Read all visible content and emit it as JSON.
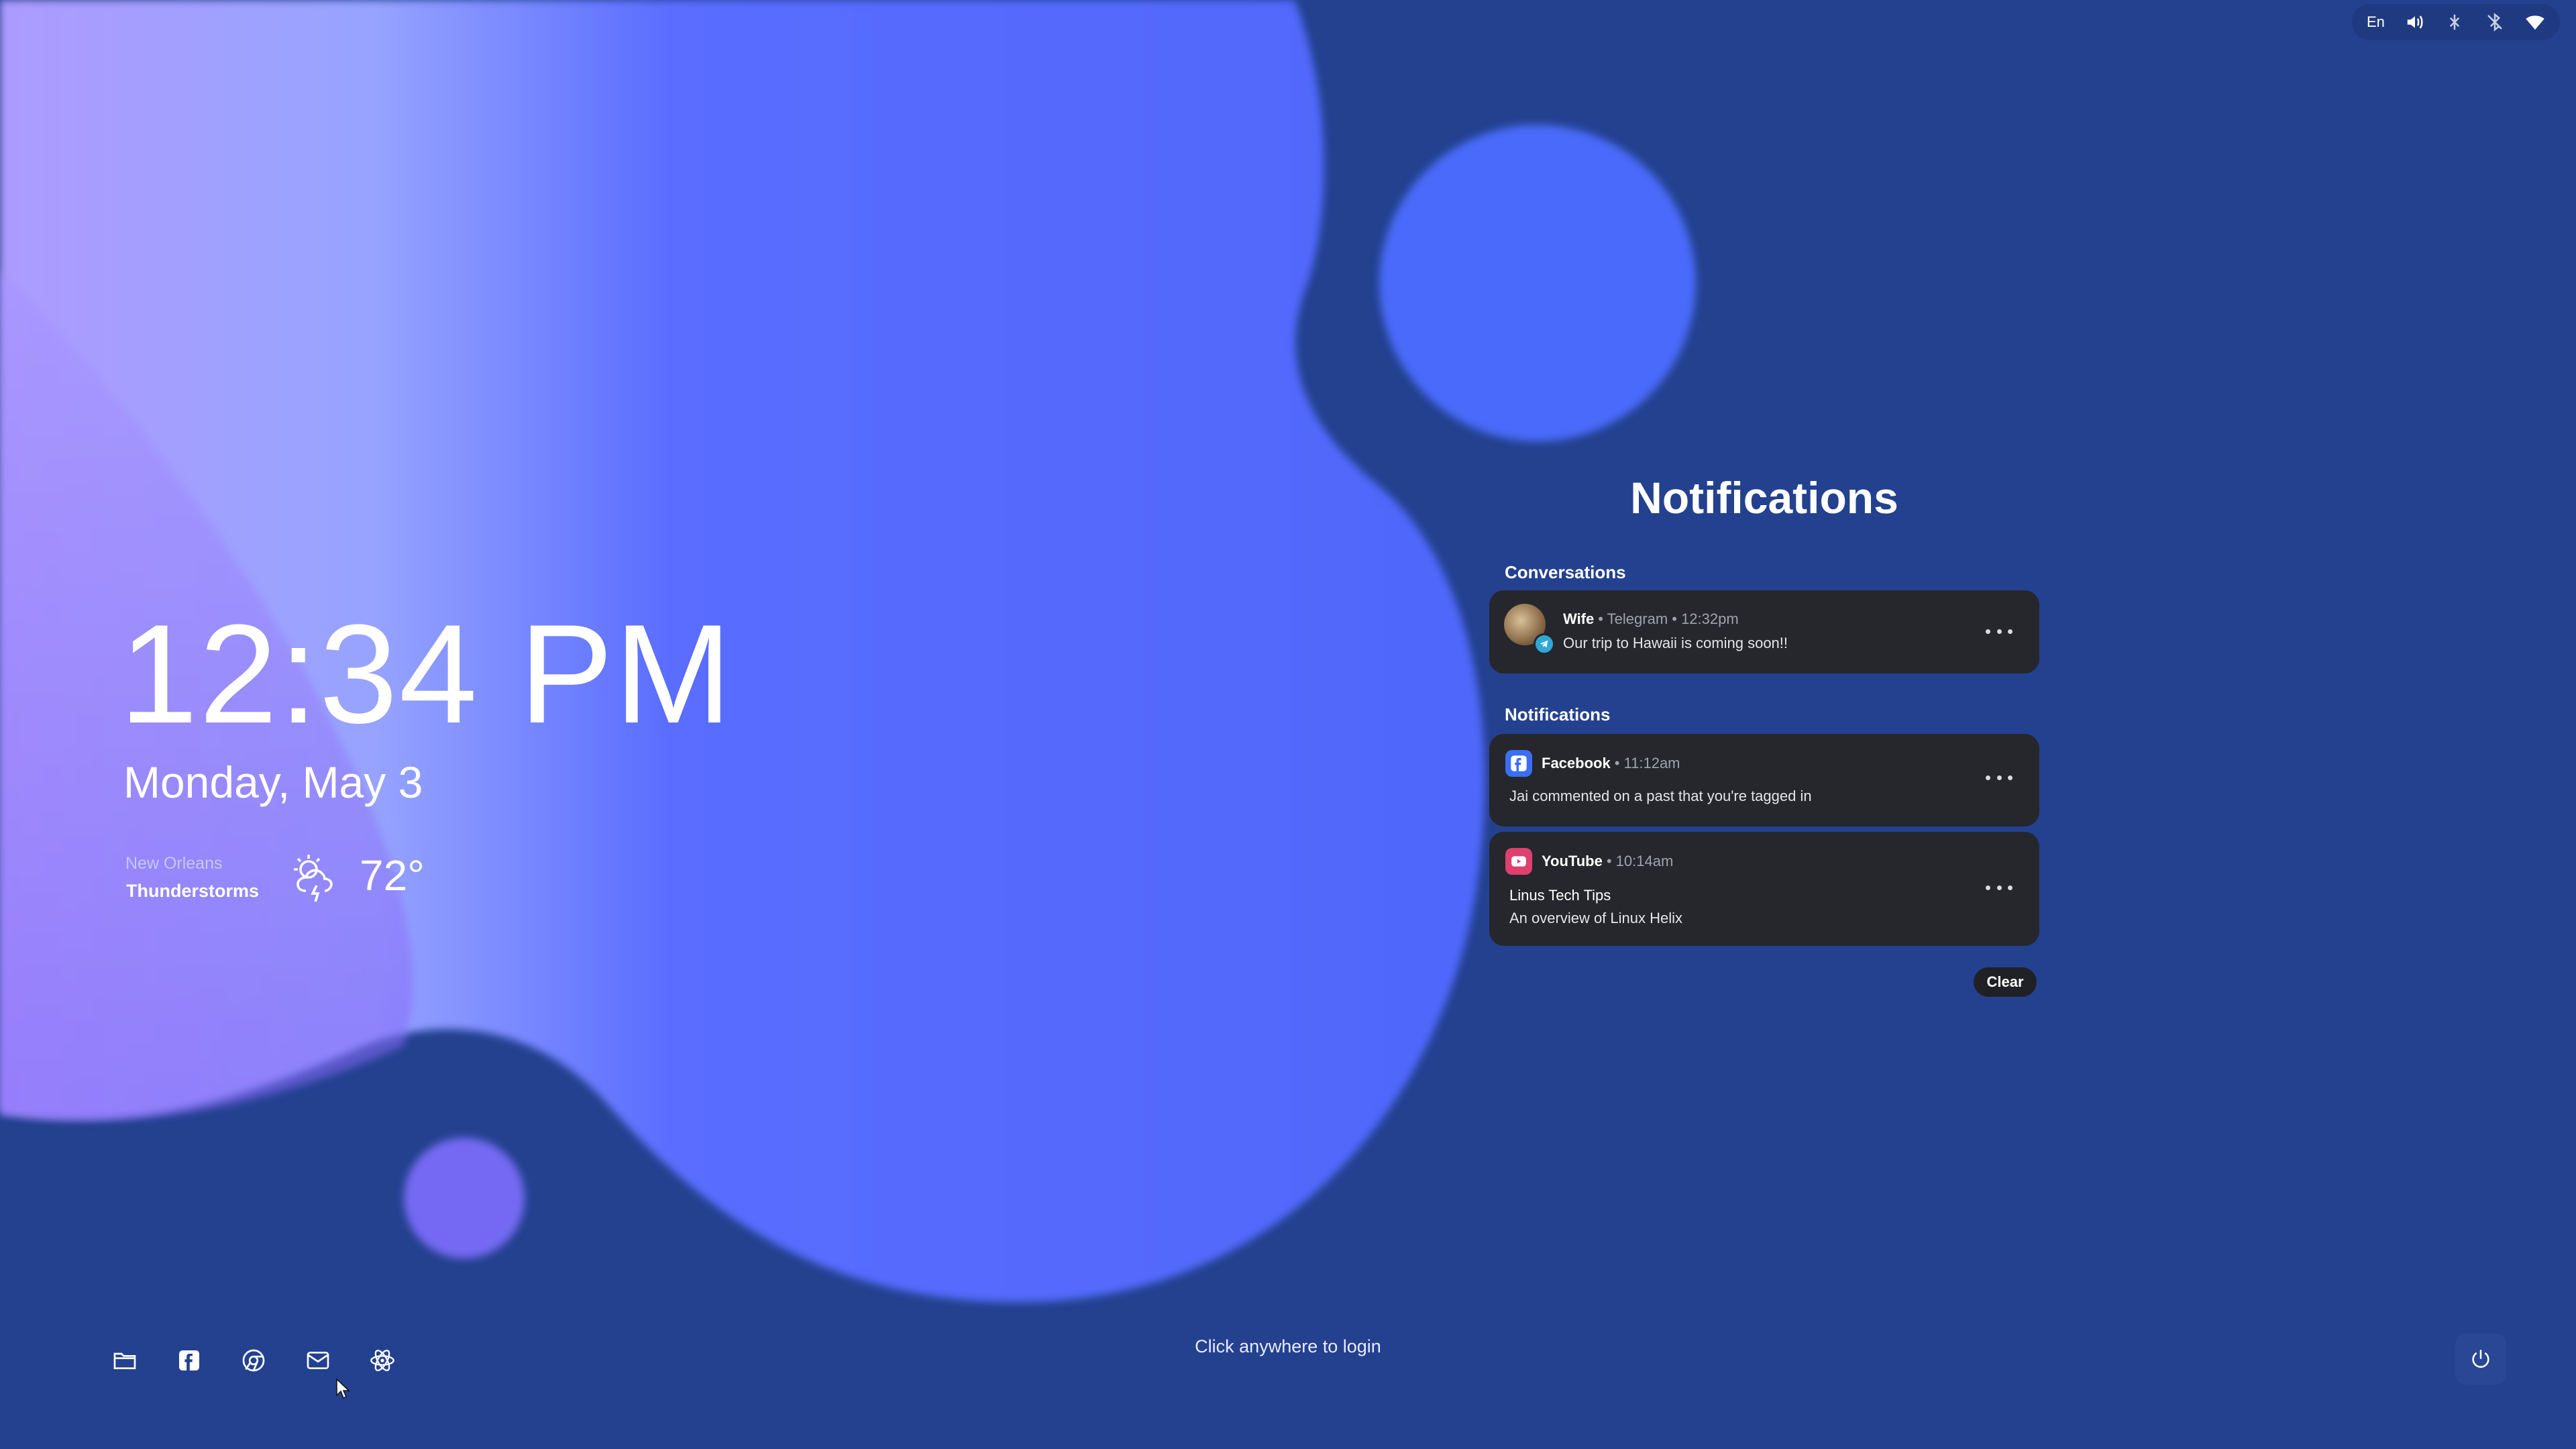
{
  "tray": {
    "language": "En",
    "icons": [
      "volume-icon",
      "network-off-icon",
      "bluetooth-off-icon",
      "wifi-icon"
    ]
  },
  "clock": {
    "time": "12:34 PM",
    "date": "Monday, May 3"
  },
  "weather": {
    "city": "New Orleans",
    "condition": "Thunderstorms",
    "temperature": "72°",
    "icon": "thunderstorm-icon"
  },
  "notifications": {
    "title": "Notifications",
    "conversations_label": "Conversations",
    "notifications_label": "Notifications",
    "conversations": [
      {
        "sender": "Wife",
        "meta": "• Telegram • 12:32pm",
        "message": "Our trip to Hawaii is coming soon!!",
        "app_icon": "telegram-icon"
      }
    ],
    "items": [
      {
        "app": "Facebook",
        "meta": "• 11:12am",
        "message": "Jai commented on a past that you're tagged in",
        "app_icon": "facebook-icon",
        "color": "#3b6ef0"
      },
      {
        "app": "YouTube",
        "meta": "• 10:14am",
        "title": "Linus Tech Tips",
        "message": "An overview of Linux Helix",
        "app_icon": "youtube-icon",
        "color": "#e0406f"
      }
    ],
    "clear_label": "Clear"
  },
  "dock": {
    "items": [
      "folder-icon",
      "facebook-icon",
      "browser-icon",
      "mail-icon",
      "react-icon"
    ]
  },
  "login_hint": "Click anywhere to login",
  "power": {
    "icon": "power-icon"
  },
  "colors": {
    "background": "#23418f",
    "blob": "#5168fb",
    "card": "#25272c",
    "facebook": "#3b6ef0",
    "youtube": "#e0406f"
  }
}
